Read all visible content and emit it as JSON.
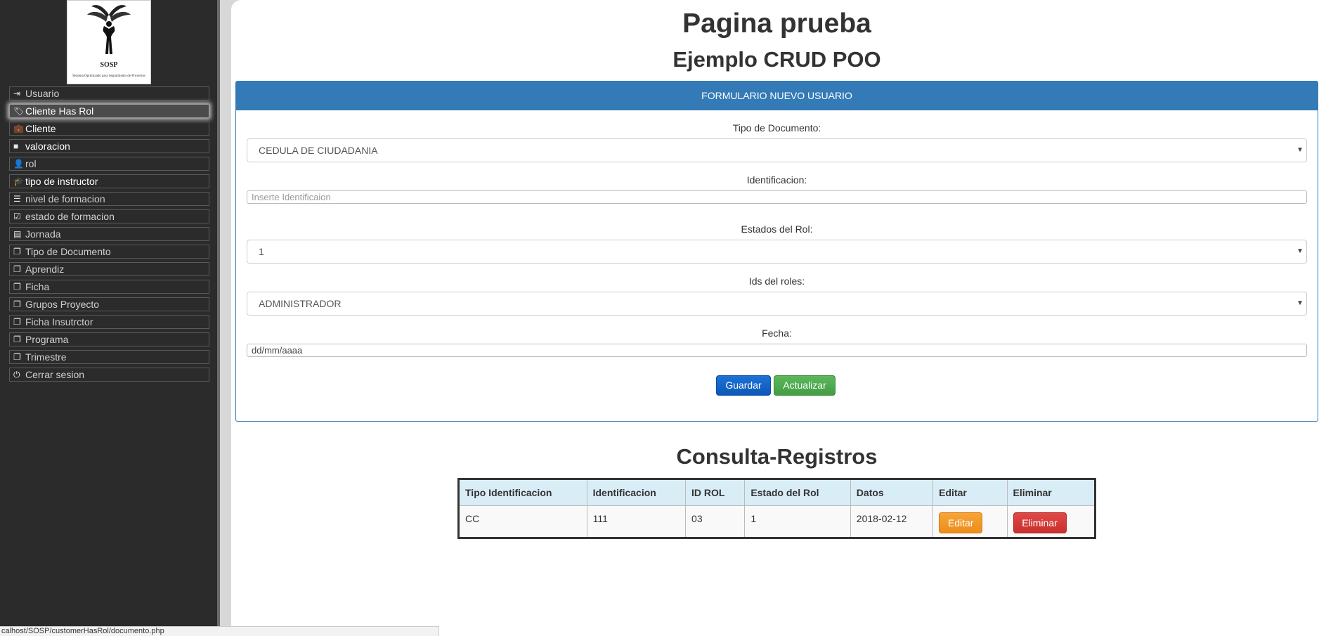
{
  "logo": {
    "title": "SOSP",
    "subtitle": "Sistema Optimizado para Seguimiento de Proyectos"
  },
  "sidebar": {
    "items": [
      {
        "icon": "sign-in-icon",
        "glyph": "⇥",
        "label": "Usuario"
      },
      {
        "icon": "tags-icon",
        "glyph": "🏷",
        "label": "Cliente Has Rol"
      },
      {
        "icon": "briefcase-icon",
        "glyph": "💼",
        "label": "Cliente"
      },
      {
        "icon": "book-icon",
        "glyph": "■",
        "label": "valoracion"
      },
      {
        "icon": "user-icon",
        "glyph": "👤",
        "label": "rol"
      },
      {
        "icon": "graduation-cap-icon",
        "glyph": "🎓",
        "label": "tipo de instructor"
      },
      {
        "icon": "list-indent-icon",
        "glyph": "☰",
        "label": "nivel de formacion"
      },
      {
        "icon": "check-square-icon",
        "glyph": "☑",
        "label": "estado de formacion"
      },
      {
        "icon": "list-alt-icon",
        "glyph": "▤",
        "label": "Jornada"
      },
      {
        "icon": "copy-icon",
        "glyph": "❐",
        "label": "Tipo de Documento"
      },
      {
        "icon": "copy-icon",
        "glyph": "❐",
        "label": "Aprendiz"
      },
      {
        "icon": "copy-icon",
        "glyph": "❐",
        "label": "Ficha"
      },
      {
        "icon": "copy-icon",
        "glyph": "❐",
        "label": "Grupos Proyecto"
      },
      {
        "icon": "copy-icon",
        "glyph": "❐",
        "label": "Ficha Insutrctor"
      },
      {
        "icon": "copy-icon",
        "glyph": "❐",
        "label": "Programa"
      },
      {
        "icon": "copy-icon",
        "glyph": "❐",
        "label": "Trimestre"
      },
      {
        "icon": "power-off-icon",
        "glyph": "⏻",
        "label": "Cerrar sesion"
      }
    ]
  },
  "page": {
    "title": "Pagina prueba",
    "subtitle": "Ejemplo CRUD POO"
  },
  "form": {
    "header": "FORMULARIO NUEVO USUARIO",
    "tipo_documento": {
      "label": "Tipo de Documento:",
      "value": "CEDULA DE CIUDADANIA"
    },
    "identificacion": {
      "label": "Identificacion:",
      "placeholder": "Inserte Identificaion"
    },
    "estados_rol": {
      "label": "Estados del Rol:",
      "value": "1"
    },
    "ids_roles": {
      "label": "Ids del roles:",
      "value": "ADMINISTRADOR"
    },
    "fecha": {
      "label": "Fecha:",
      "placeholder": "dd/mm/aaaa"
    },
    "guardar_label": "Guardar",
    "actualizar_label": "Actualizar"
  },
  "consulta": {
    "title": "Consulta-Registros",
    "headers": [
      "Tipo Identificacion",
      "Identificacion",
      "ID ROL",
      "Estado del Rol",
      "Datos",
      "Editar",
      "Eliminar"
    ],
    "rows": [
      {
        "tipo": "CC",
        "identificacion": "111",
        "id_rol": "03",
        "estado": "1",
        "datos": "2018-02-12",
        "editar": "Editar",
        "eliminar": "Eliminar"
      }
    ]
  },
  "statusbar": {
    "url": "calhost/SOSP/customerHasRol/documento.php"
  },
  "colors": {
    "primary": "#337ab7",
    "success": "#5cb85c",
    "warning": "#f0ad4e",
    "danger": "#d9534f",
    "sidebar": "#2b2b2b",
    "table_header": "#d9edf7"
  }
}
